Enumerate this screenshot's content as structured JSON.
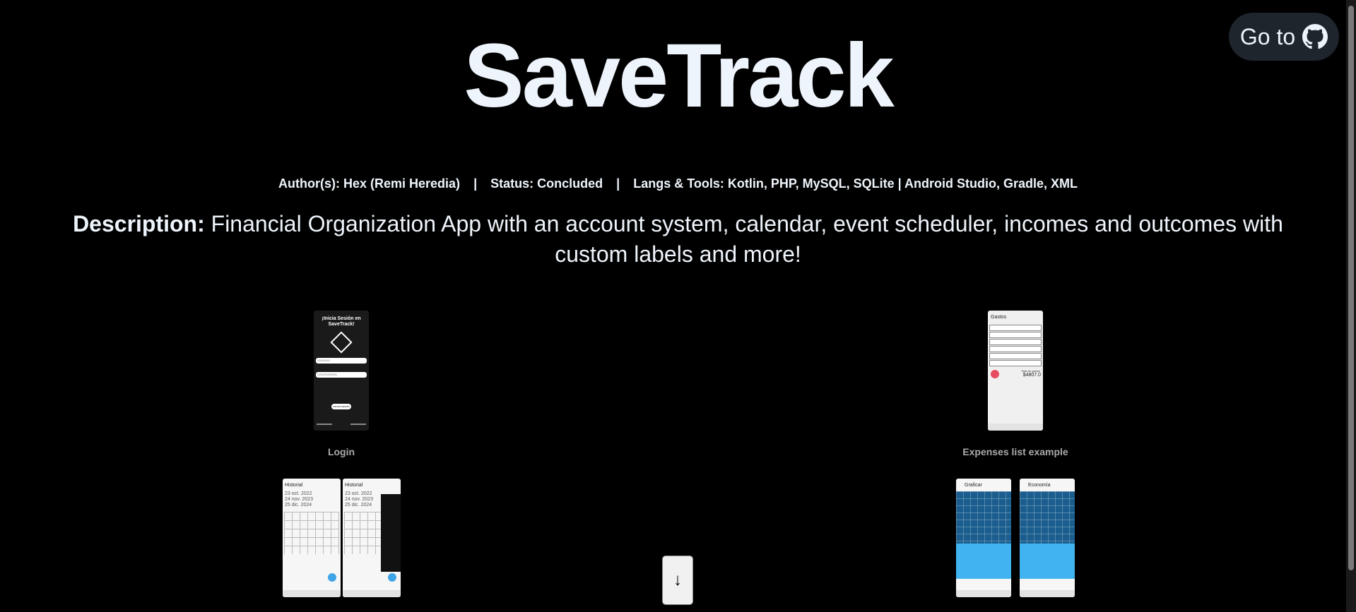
{
  "page": {
    "title": "SaveTrack",
    "goto_label": "Go to",
    "meta": {
      "authors": "Author(s): Hex (Remi Heredia)",
      "status": "Status: Concluded",
      "tools": "Langs & Tools: Kotlin, PHP, MySQL, SQLite | Android Studio, Gradle, XML",
      "separator": "|"
    },
    "description_label": "Description:",
    "description_text": "Financial Organization App with an account system, calendar, event scheduler, incomes and outcomes with custom labels and more!"
  },
  "screens": {
    "login": {
      "caption": "Login",
      "heading": "¡Inicia Sesión en SaveTrack!",
      "user_placeholder": "USUARIO",
      "pass_placeholder": "CONTRASEÑA",
      "button": "INICIAR SESIÓN"
    },
    "expenses": {
      "caption": "Expenses list example",
      "heading": "Gastos",
      "total_label": "Total de gastos",
      "total": "$4807.0"
    },
    "history": {
      "heading": "Historial",
      "dates": [
        "23 oct. 2022",
        "24 nov. 2023",
        "25 dic. 2024"
      ]
    },
    "graphs": {
      "left_heading": "Graficar",
      "right_heading": "Economía"
    }
  },
  "controls": {
    "scroll_down_glyph": "↓"
  },
  "colors": {
    "background": "#000000",
    "text": "#eef4fb",
    "button_bg": "#1e252d",
    "caption": "#aaaaaa"
  }
}
